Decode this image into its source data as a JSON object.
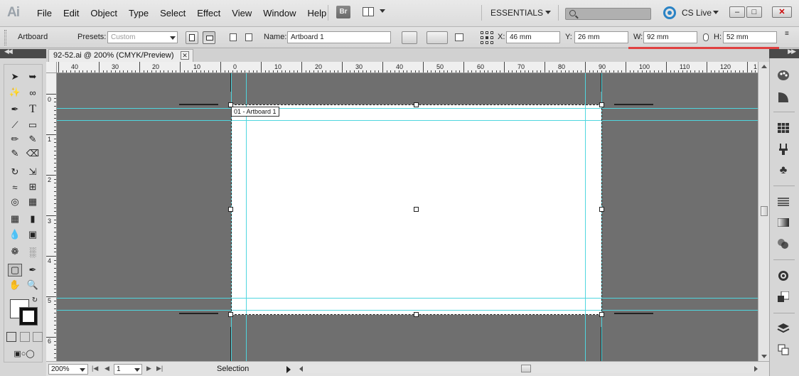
{
  "app": {
    "logo": "Ai",
    "menu": [
      "File",
      "Edit",
      "Object",
      "Type",
      "Select",
      "Effect",
      "View",
      "Window",
      "Help"
    ],
    "bridge_label": "Br",
    "workspace": "ESSENTIALS",
    "search_placeholder": "",
    "cs_live": "CS Live"
  },
  "control_bar": {
    "tool_name": "Artboard",
    "presets_label": "Presets:",
    "presets_value": "Custom",
    "name_label": "Name:",
    "name_value": "Artboard 1",
    "x_label": "X:",
    "x_value": "46 mm",
    "y_label": "Y:",
    "y_value": "26 mm",
    "w_label": "W:",
    "w_value": "92 mm",
    "h_label": "H:",
    "h_value": "52 mm"
  },
  "document": {
    "tab_title": "92-52.ai @ 200% (CMYK/Preview)",
    "artboard_label": "01 - Artboard 1"
  },
  "rulers": {
    "top": [
      "40",
      "30",
      "20",
      "10",
      "0",
      "10",
      "20",
      "30",
      "40",
      "50",
      "60",
      "70",
      "80",
      "90",
      "100",
      "110",
      "120",
      "1"
    ],
    "left": [
      "0",
      "1",
      "2",
      "3",
      "4",
      "5",
      "6"
    ]
  },
  "status": {
    "zoom": "200%",
    "page": "1",
    "tool": "Selection"
  },
  "colors": {
    "guide": "#4fd6df",
    "canvas": "#6f6f6f",
    "cslive": "#2a83c5",
    "highlight": "#e04040"
  }
}
